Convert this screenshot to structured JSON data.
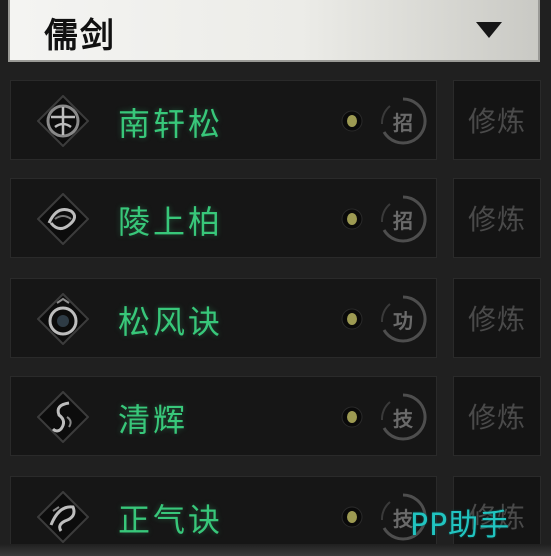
{
  "header": {
    "title": "儒剑"
  },
  "skills": [
    {
      "name": "南轩松",
      "type": "招",
      "action": "修炼"
    },
    {
      "name": "陵上柏",
      "type": "招",
      "action": "修炼"
    },
    {
      "name": "松风诀",
      "type": "功",
      "action": "修炼"
    },
    {
      "name": "清辉",
      "type": "技",
      "action": "修炼"
    },
    {
      "name": "正气诀",
      "type": "技",
      "action": "修炼"
    }
  ],
  "watermark": "PP助手",
  "colors": {
    "skill_name": "#38c77a",
    "watermark": "#21c4c0",
    "train_text": "#4a4a4a"
  }
}
